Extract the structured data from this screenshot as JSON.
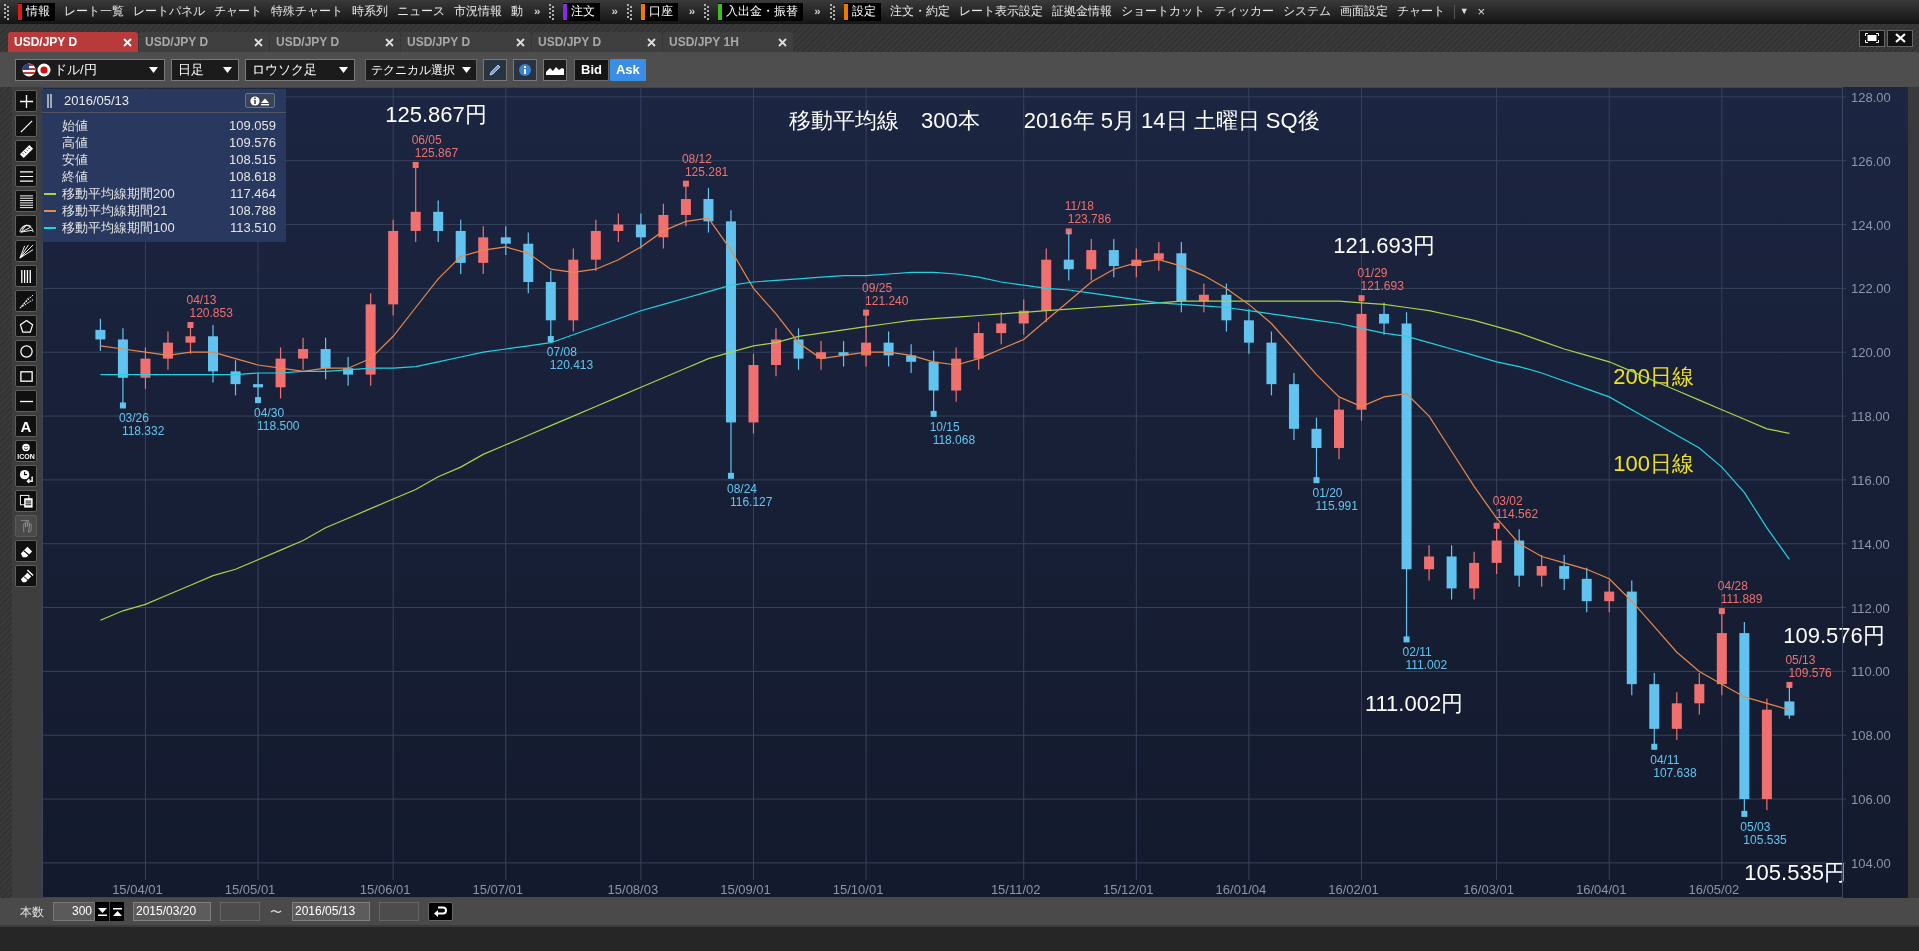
{
  "menu": [
    {
      "kind": "section",
      "label": "情報",
      "color": "#e01818"
    },
    {
      "kind": "item",
      "label": "レート一覧"
    },
    {
      "kind": "item",
      "label": "レートパネル"
    },
    {
      "kind": "item",
      "label": "チャート"
    },
    {
      "kind": "item",
      "label": "特殊チャート"
    },
    {
      "kind": "item",
      "label": "時系列"
    },
    {
      "kind": "item",
      "label": "ニュース"
    },
    {
      "kind": "item",
      "label": "市況情報"
    },
    {
      "kind": "item",
      "label": "動"
    },
    {
      "kind": "more",
      "label": "»"
    },
    {
      "kind": "section",
      "label": "注文",
      "color": "#8a2be2"
    },
    {
      "kind": "more",
      "label": "»"
    },
    {
      "kind": "section",
      "label": "口座",
      "color": "#f07800"
    },
    {
      "kind": "more",
      "label": "»"
    },
    {
      "kind": "section",
      "label": "入出金・振替",
      "color": "#38c020"
    },
    {
      "kind": "more",
      "label": "»"
    },
    {
      "kind": "section",
      "label": "設定",
      "color": "#f07800"
    },
    {
      "kind": "item",
      "label": "注文・約定"
    },
    {
      "kind": "item",
      "label": "レート表示設定"
    },
    {
      "kind": "item",
      "label": "証拠金情報"
    },
    {
      "kind": "item",
      "label": "ショートカット"
    },
    {
      "kind": "item",
      "label": "ティッカー"
    },
    {
      "kind": "item",
      "label": "システム"
    },
    {
      "kind": "item",
      "label": "画面設定"
    },
    {
      "kind": "item",
      "label": "チャート"
    },
    {
      "kind": "dropdown",
      "label": "▼"
    },
    {
      "kind": "close",
      "label": "×"
    }
  ],
  "tabs": [
    {
      "label": "USD/JPY D",
      "selected": true
    },
    {
      "label": "USD/JPY D",
      "selected": false
    },
    {
      "label": "USD/JPY D",
      "selected": false
    },
    {
      "label": "USD/JPY D",
      "selected": false
    },
    {
      "label": "USD/JPY D",
      "selected": false
    },
    {
      "label": "USD/JPY 1H",
      "selected": false
    }
  ],
  "toolbar": {
    "pair": "ドル/円",
    "period": "日足",
    "chart_type": "ロウソク足",
    "technical": "テクニカル選択",
    "price_mode": [
      {
        "label": "Bid",
        "selected": false
      },
      {
        "label": "Ask",
        "selected": true
      }
    ]
  },
  "tools": [
    {
      "kind": "crosshair",
      "disabled": false
    },
    {
      "kind": "line",
      "disabled": false
    },
    {
      "kind": "ruler",
      "disabled": false
    },
    {
      "kind": "lines3",
      "disabled": false
    },
    {
      "kind": "lines6",
      "disabled": false
    },
    {
      "kind": "arcfan",
      "disabled": false
    },
    {
      "kind": "fan",
      "disabled": false
    },
    {
      "kind": "vlines",
      "disabled": false
    },
    {
      "kind": "fan2",
      "disabled": false
    },
    {
      "kind": "pentagon",
      "disabled": false
    },
    {
      "kind": "circle",
      "disabled": false
    },
    {
      "kind": "rect",
      "disabled": false
    },
    {
      "kind": "hline",
      "disabled": false
    },
    {
      "kind": "text",
      "label": "A",
      "disabled": false
    },
    {
      "kind": "emoji",
      "label": "ICON",
      "disabled": false
    },
    {
      "kind": "clock",
      "disabled": false
    },
    {
      "kind": "copy",
      "disabled": false
    },
    {
      "kind": "hand",
      "disabled": true
    },
    {
      "kind": "eraser",
      "disabled": false
    },
    {
      "kind": "eraser2",
      "disabled": false
    }
  ],
  "legend": {
    "date": "2016/05/13",
    "rows": [
      {
        "label": "始値",
        "value": "109.059"
      },
      {
        "label": "高値",
        "value": "109.576"
      },
      {
        "label": "安値",
        "value": "108.515"
      },
      {
        "label": "終値",
        "value": "108.618"
      },
      {
        "label": "移動平均線期間200",
        "value": "117.464",
        "color": "#a8d448"
      },
      {
        "label": "移動平均線期間21",
        "value": "108.788",
        "color": "#e8884a"
      },
      {
        "label": "移動平均線期間100",
        "value": "113.510",
        "color": "#22d2e0"
      }
    ]
  },
  "chart": {
    "chart_data": {
      "type": "candlestick",
      "grid": true,
      "ylim": [
        102.9,
        128.31
      ],
      "categories": [
        null,
        null,
        "15/04/01",
        null,
        null,
        null,
        null,
        "15/05/01",
        null,
        null,
        null,
        null,
        null,
        "15/06/01",
        null,
        null,
        null,
        null,
        "15/07/01",
        null,
        null,
        null,
        null,
        null,
        "15/08/03",
        null,
        null,
        null,
        null,
        "15/09/01",
        null,
        null,
        null,
        null,
        "15/10/01",
        null,
        null,
        null,
        null,
        null,
        null,
        "15/11/02",
        null,
        null,
        null,
        null,
        "15/12/01",
        null,
        null,
        null,
        null,
        "16/01/04",
        null,
        null,
        null,
        null,
        "16/02/01",
        null,
        null,
        null,
        null,
        null,
        "16/03/01",
        null,
        null,
        null,
        null,
        "16/04/01",
        null,
        null,
        null,
        null,
        "16/05/02",
        null,
        null,
        null
      ],
      "yticks": [
        {
          "value": 104,
          "label": "104.00"
        },
        {
          "value": 106,
          "label": "106.00"
        },
        {
          "value": 108,
          "label": "108.00"
        },
        {
          "value": 110,
          "label": "110.00"
        },
        {
          "value": 112,
          "label": "112.00"
        },
        {
          "value": 114,
          "label": "114.00"
        },
        {
          "value": 116,
          "label": "116.00"
        },
        {
          "value": 118,
          "label": "118.00"
        },
        {
          "value": 120,
          "label": "120.00"
        },
        {
          "value": 122,
          "label": "122.00"
        },
        {
          "value": 124,
          "label": "124.00"
        },
        {
          "value": 126,
          "label": "126.00"
        },
        {
          "value": 128,
          "label": "128.00"
        }
      ],
      "ohlc": [
        [
          120.7,
          121.05,
          120.05,
          120.4
        ],
        [
          120.4,
          120.75,
          118.332,
          119.2
        ],
        [
          119.2,
          120.15,
          118.85,
          119.8
        ],
        [
          119.8,
          120.65,
          119.45,
          120.3
        ],
        [
          120.3,
          120.853,
          119.95,
          120.5
        ],
        [
          120.5,
          120.85,
          119.05,
          119.4
        ],
        [
          119.4,
          119.75,
          118.65,
          119.0
        ],
        [
          119.0,
          119.35,
          118.5,
          118.9
        ],
        [
          118.9,
          120.15,
          118.55,
          119.8
        ],
        [
          119.8,
          120.45,
          119.45,
          120.1
        ],
        [
          120.1,
          120.45,
          119.15,
          119.5
        ],
        [
          119.5,
          119.85,
          118.95,
          119.3
        ],
        [
          119.3,
          121.85,
          118.95,
          121.5
        ],
        [
          121.5,
          124.15,
          121.15,
          123.8
        ],
        [
          123.8,
          125.867,
          123.45,
          124.4
        ],
        [
          124.4,
          124.75,
          123.45,
          123.8
        ],
        [
          123.8,
          124.15,
          122.45,
          122.8
        ],
        [
          122.8,
          123.95,
          122.45,
          123.6
        ],
        [
          123.6,
          123.95,
          123.05,
          123.4
        ],
        [
          123.4,
          123.75,
          121.85,
          122.2
        ],
        [
          122.2,
          122.55,
          120.413,
          121.0
        ],
        [
          121.0,
          123.25,
          120.65,
          122.9
        ],
        [
          122.9,
          124.15,
          122.55,
          123.8
        ],
        [
          123.8,
          124.35,
          123.45,
          124.0
        ],
        [
          124.0,
          124.35,
          123.25,
          123.6
        ],
        [
          123.6,
          124.65,
          123.25,
          124.3
        ],
        [
          124.3,
          125.281,
          123.95,
          124.8
        ],
        [
          124.8,
          125.15,
          123.75,
          124.1
        ],
        [
          124.1,
          124.45,
          116.127,
          117.8
        ],
        [
          117.8,
          119.95,
          117.45,
          119.6
        ],
        [
          119.6,
          120.75,
          119.25,
          120.4
        ],
        [
          120.4,
          120.75,
          119.45,
          119.8
        ],
        [
          119.8,
          120.35,
          119.45,
          120.0
        ],
        [
          120.0,
          120.35,
          119.55,
          119.9
        ],
        [
          119.9,
          121.24,
          119.55,
          120.3
        ],
        [
          120.3,
          120.65,
          119.55,
          119.9
        ],
        [
          119.9,
          120.25,
          119.35,
          119.7
        ],
        [
          119.7,
          120.05,
          118.068,
          118.8
        ],
        [
          118.8,
          120.15,
          118.45,
          119.8
        ],
        [
          119.8,
          120.95,
          119.45,
          120.6
        ],
        [
          120.6,
          121.25,
          120.25,
          120.9
        ],
        [
          120.9,
          121.65,
          120.55,
          121.3
        ],
        [
          121.3,
          123.25,
          120.95,
          122.9
        ],
        [
          122.9,
          123.786,
          122.25,
          122.6
        ],
        [
          122.6,
          123.55,
          122.25,
          123.2
        ],
        [
          123.2,
          123.55,
          122.35,
          122.7
        ],
        [
          122.7,
          123.25,
          122.35,
          122.9
        ],
        [
          122.9,
          123.45,
          122.55,
          123.1
        ],
        [
          123.1,
          123.45,
          121.25,
          121.6
        ],
        [
          121.6,
          122.15,
          121.25,
          121.8
        ],
        [
          121.8,
          122.15,
          120.65,
          121.0
        ],
        [
          121.0,
          121.35,
          119.95,
          120.3
        ],
        [
          120.3,
          120.65,
          118.65,
          119.0
        ],
        [
          119.0,
          119.35,
          117.25,
          117.6
        ],
        [
          117.6,
          117.95,
          115.991,
          117.0
        ],
        [
          117.0,
          118.55,
          116.65,
          118.2
        ],
        [
          118.2,
          121.693,
          117.85,
          121.2
        ],
        [
          121.2,
          121.55,
          120.55,
          120.9
        ],
        [
          120.9,
          121.25,
          111.002,
          113.2
        ],
        [
          113.2,
          113.95,
          112.85,
          113.6
        ],
        [
          113.6,
          113.95,
          112.25,
          112.6
        ],
        [
          112.6,
          113.75,
          112.25,
          113.4
        ],
        [
          113.4,
          114.562,
          113.05,
          114.1
        ],
        [
          114.1,
          114.45,
          112.65,
          113.0
        ],
        [
          113.0,
          113.65,
          112.65,
          113.3
        ],
        [
          113.3,
          113.65,
          112.55,
          112.9
        ],
        [
          112.9,
          113.25,
          111.85,
          112.2
        ],
        [
          112.2,
          112.85,
          111.85,
          112.5
        ],
        [
          112.5,
          112.85,
          109.25,
          109.6
        ],
        [
          109.6,
          109.95,
          107.638,
          108.2
        ],
        [
          108.2,
          109.35,
          107.85,
          109.0
        ],
        [
          109.0,
          109.95,
          108.65,
          109.6
        ],
        [
          109.6,
          111.889,
          109.25,
          111.2
        ],
        [
          111.2,
          111.55,
          105.535,
          106.0
        ],
        [
          106.0,
          109.15,
          105.65,
          108.8
        ],
        [
          109.059,
          109.576,
          108.515,
          108.618
        ]
      ]
    },
    "moving_averages": {
      "chart_data": {
        "type": "line",
        "ylim": [
          102.9,
          128.31
        ],
        "series": [
          {
            "color": "#a8d448",
            "values": [
              111.6,
              111.9,
              112.1,
              112.4,
              112.7,
              113.0,
              113.2,
              113.5,
              113.8,
              114.1,
              114.5,
              114.8,
              115.1,
              115.4,
              115.7,
              116.1,
              116.4,
              116.8,
              117.1,
              117.4,
              117.7,
              118.0,
              118.3,
              118.6,
              118.9,
              119.2,
              119.5,
              119.8,
              120.0,
              120.2,
              120.3,
              120.5,
              120.6,
              120.7,
              120.8,
              120.9,
              121.0,
              121.05,
              121.1,
              121.15,
              121.2,
              121.25,
              121.3,
              121.35,
              121.4,
              121.45,
              121.5,
              121.55,
              121.6,
              121.6,
              121.6,
              121.6,
              121.6,
              121.6,
              121.6,
              121.6,
              121.55,
              121.5,
              121.4,
              121.3,
              121.15,
              121.0,
              120.8,
              120.6,
              120.35,
              120.1,
              119.9,
              119.7,
              119.4,
              119.1,
              118.8,
              118.5,
              118.2,
              117.9,
              117.6,
              117.46
            ]
          },
          {
            "color": "#e8884a",
            "values": [
              120.2,
              120.1,
              120.0,
              119.9,
              120.0,
              120.0,
              119.8,
              119.6,
              119.5,
              119.4,
              119.5,
              119.5,
              119.8,
              120.5,
              121.4,
              122.3,
              123.0,
              123.2,
              123.3,
              123.1,
              122.6,
              122.5,
              122.6,
              122.9,
              123.3,
              123.8,
              124.1,
              124.2,
              123.2,
              122.0,
              121.2,
              120.3,
              119.8,
              119.9,
              120.0,
              120.0,
              119.9,
              119.7,
              119.6,
              119.8,
              120.1,
              120.4,
              121.0,
              121.6,
              122.2,
              122.6,
              122.8,
              122.9,
              122.7,
              122.4,
              122.0,
              121.5,
              120.9,
              120.1,
              119.3,
              118.6,
              118.3,
              118.6,
              118.7,
              118.0,
              116.9,
              115.8,
              114.8,
              114.0,
              113.6,
              113.4,
              113.2,
              112.9,
              112.2,
              111.4,
              110.6,
              110.0,
              109.6,
              109.2,
              109.0,
              108.79
            ]
          },
          {
            "color": "#22d2e0",
            "values": [
              119.3,
              119.3,
              119.3,
              119.3,
              119.3,
              119.3,
              119.3,
              119.35,
              119.35,
              119.4,
              119.4,
              119.45,
              119.5,
              119.5,
              119.55,
              119.7,
              119.85,
              120.0,
              120.1,
              120.2,
              120.3,
              120.55,
              120.8,
              121.05,
              121.3,
              121.5,
              121.7,
              121.9,
              122.1,
              122.2,
              122.25,
              122.3,
              122.35,
              122.4,
              122.4,
              122.45,
              122.5,
              122.5,
              122.45,
              122.35,
              122.2,
              122.1,
              122.0,
              121.95,
              121.85,
              121.75,
              121.65,
              121.55,
              121.5,
              121.45,
              121.4,
              121.3,
              121.2,
              121.1,
              121.0,
              120.9,
              120.75,
              120.6,
              120.5,
              120.3,
              120.1,
              119.9,
              119.7,
              119.55,
              119.35,
              119.1,
              118.85,
              118.6,
              118.2,
              117.8,
              117.4,
              117.0,
              116.4,
              115.6,
              114.5,
              113.51
            ]
          }
        ]
      }
    },
    "extremes": [
      {
        "kind": "low",
        "date": "03/26",
        "price": "118.332"
      },
      {
        "kind": "high",
        "date": "04/13",
        "price": "120.853"
      },
      {
        "kind": "low",
        "date": "04/30",
        "price": "118.500"
      },
      {
        "kind": "high",
        "date": "06/05",
        "price": "125.867"
      },
      {
        "kind": "low",
        "date": "07/08",
        "price": "120.413"
      },
      {
        "kind": "high",
        "date": "08/12",
        "price": "125.281"
      },
      {
        "kind": "low",
        "date": "08/24",
        "price": "116.127"
      },
      {
        "kind": "high",
        "date": "09/25",
        "price": "121.240"
      },
      {
        "kind": "low",
        "date": "10/15",
        "price": "118.068"
      },
      {
        "kind": "high",
        "date": "11/18",
        "price": "123.786"
      },
      {
        "kind": "low",
        "date": "01/20",
        "price": "115.991"
      },
      {
        "kind": "high",
        "date": "01/29",
        "price": "121.693"
      },
      {
        "kind": "low",
        "date": "02/11",
        "price": "111.002"
      },
      {
        "kind": "high",
        "date": "03/02",
        "price": "114.562"
      },
      {
        "kind": "low",
        "date": "04/11",
        "price": "107.638"
      },
      {
        "kind": "high",
        "date": "04/28",
        "price": "111.889"
      },
      {
        "kind": "low",
        "date": "05/03",
        "price": "105.535"
      },
      {
        "kind": "high",
        "date": "05/13",
        "price": "109.576"
      }
    ],
    "notes": [
      {
        "text": "125.867円",
        "color": "#ffffff"
      },
      {
        "text": "移動平均線　300本　　2016年 5月 14日 土曜日 SQ後",
        "color": "#ffffff"
      },
      {
        "text": "121.693円",
        "color": "#ffffff"
      },
      {
        "text": "200日線",
        "color": "#f0e020"
      },
      {
        "text": "100日線",
        "color": "#f0e020"
      },
      {
        "text": "109.576円",
        "color": "#ffffff"
      },
      {
        "text": "111.002円",
        "color": "#ffffff"
      },
      {
        "text": "105.535円",
        "color": "#ffffff"
      }
    ]
  },
  "bottom": {
    "bars_label": "本数",
    "bars_value": "300",
    "from_date": "2015/03/20",
    "separator": "〜",
    "to_date": "2016/05/13"
  }
}
